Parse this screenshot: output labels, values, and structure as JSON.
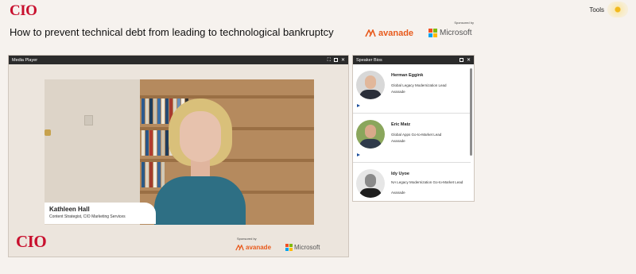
{
  "header": {
    "logo_text": "CIO",
    "tools_label": "Tools",
    "page_title": "How to prevent technical debt from leading to technological bankruptcy",
    "sponsored_label": "Sponsored by",
    "sponsor_1": "avanade",
    "sponsor_2": "Microsoft"
  },
  "media_player": {
    "title": "Media Player",
    "speaker_name": "Kathleen Hall",
    "speaker_role": "Content Strategist, CIO Marketing Services",
    "logo_text": "CIO",
    "sponsored_label": "Sponsored by",
    "sponsor_1": "avanade",
    "sponsor_2": "Microsoft"
  },
  "speaker_bios": {
    "title": "Speaker Bios",
    "items": [
      {
        "name": "Herman Eggink",
        "role": "Global Legacy Modernization Lead",
        "org": "Avanade"
      },
      {
        "name": "Eric Matz",
        "role": "Global Apps Go-to-Market Lead",
        "org": "Avanade"
      },
      {
        "name": "Idy Uyoe",
        "role": "NA Legacy Modernization Go-to-Market Lead",
        "org": "Avanade"
      }
    ]
  },
  "colors": {
    "brand_red": "#c8102e",
    "avanade_orange": "#e85a1c",
    "panel_bar": "#2b2b2b"
  }
}
